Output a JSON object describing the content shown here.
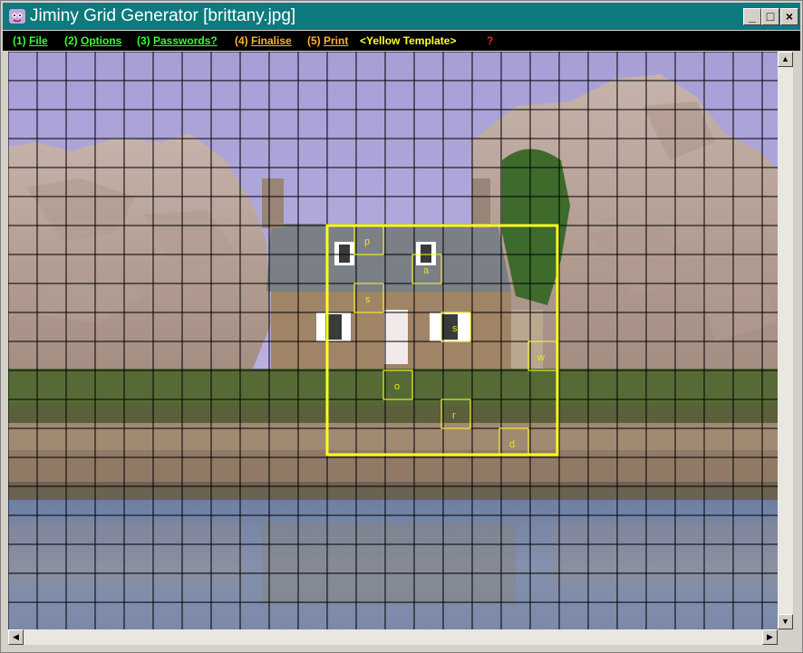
{
  "window": {
    "title": "Jiminy Grid Generator [brittany.jpg]",
    "controls": {
      "minimize": "_",
      "maximize": "□",
      "close": "×"
    }
  },
  "menu": {
    "items": [
      {
        "prefix": "(1) ",
        "label": "File",
        "color": "#33ff33"
      },
      {
        "prefix": "(2) ",
        "label": "Options",
        "color": "#33ff33"
      },
      {
        "prefix": "(3) ",
        "label": "Passwords?",
        "color": "#33ff33"
      },
      {
        "prefix": "(4) ",
        "label": "Finalise",
        "color": "#ffb030"
      },
      {
        "prefix": "(5) ",
        "label": "Print",
        "color": "#ffb030"
      },
      {
        "prefix": "",
        "label": "<Yellow Template>",
        "color": "#ffff33"
      },
      {
        "prefix": "",
        "label": "?",
        "color": "#ff2020"
      }
    ]
  },
  "grid": {
    "columns": 27,
    "rows": 20,
    "line_color": "#000000"
  },
  "template": {
    "color": "#ffff22",
    "letters": [
      "p",
      "a",
      "s",
      "s",
      "w",
      "o",
      "r",
      "d"
    ]
  },
  "scrollbars": {
    "up": "▲",
    "down": "▼",
    "left": "◀",
    "right": "▶"
  }
}
